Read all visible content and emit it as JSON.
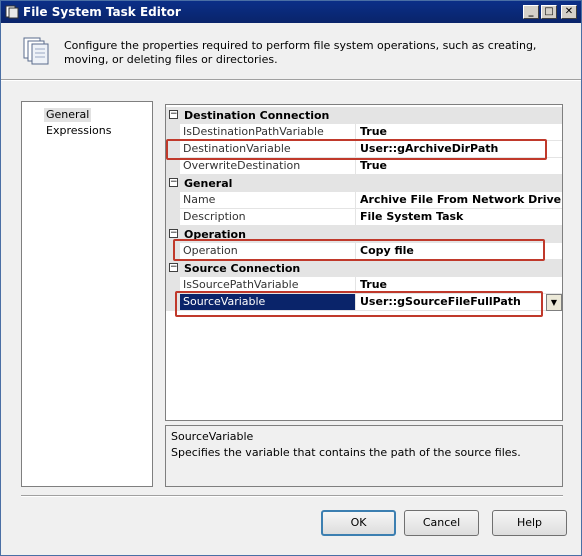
{
  "window": {
    "title": "File System Task Editor",
    "minimize_glyph": "_",
    "maximize_glyph": "□",
    "close_glyph": "✕"
  },
  "header": {
    "description": "Configure the properties required to perform file system operations, such as creating, moving, or deleting files or directories.",
    "icon": "file-stack-icon"
  },
  "nav": {
    "items": [
      {
        "label": "General",
        "selected": true
      },
      {
        "label": "Expressions",
        "selected": false
      }
    ]
  },
  "grid": {
    "categories": [
      {
        "label": "Destination Connection",
        "toggle": "⊟",
        "properties": [
          {
            "name": "IsDestinationPathVariable",
            "value": "True"
          },
          {
            "name": "DestinationVariable",
            "value": "User::gArchiveDirPath"
          },
          {
            "name": "OverwriteDestination",
            "value": "True"
          }
        ]
      },
      {
        "label": "General",
        "toggle": "⊟",
        "properties": [
          {
            "name": "Name",
            "value": "Archive File From Network Drive"
          },
          {
            "name": "Description",
            "value": "File System Task"
          }
        ]
      },
      {
        "label": "Operation",
        "toggle": "⊟",
        "properties": [
          {
            "name": "Operation",
            "value": "Copy file"
          }
        ]
      },
      {
        "label": "Source Connection",
        "toggle": "⊟",
        "properties": [
          {
            "name": "IsSourcePathVariable",
            "value": "True"
          },
          {
            "name": "SourceVariable",
            "value": "User::gSourceFileFullPath",
            "selected": true
          }
        ]
      }
    ],
    "dropdown_glyph": "▼",
    "highlight_color": "#c0392b",
    "selection_color": "#0a246a"
  },
  "description_panel": {
    "title": "SourceVariable",
    "text": "Specifies the variable that contains the path of the source files."
  },
  "buttons": {
    "ok": "OK",
    "cancel": "Cancel",
    "help": "Help"
  }
}
